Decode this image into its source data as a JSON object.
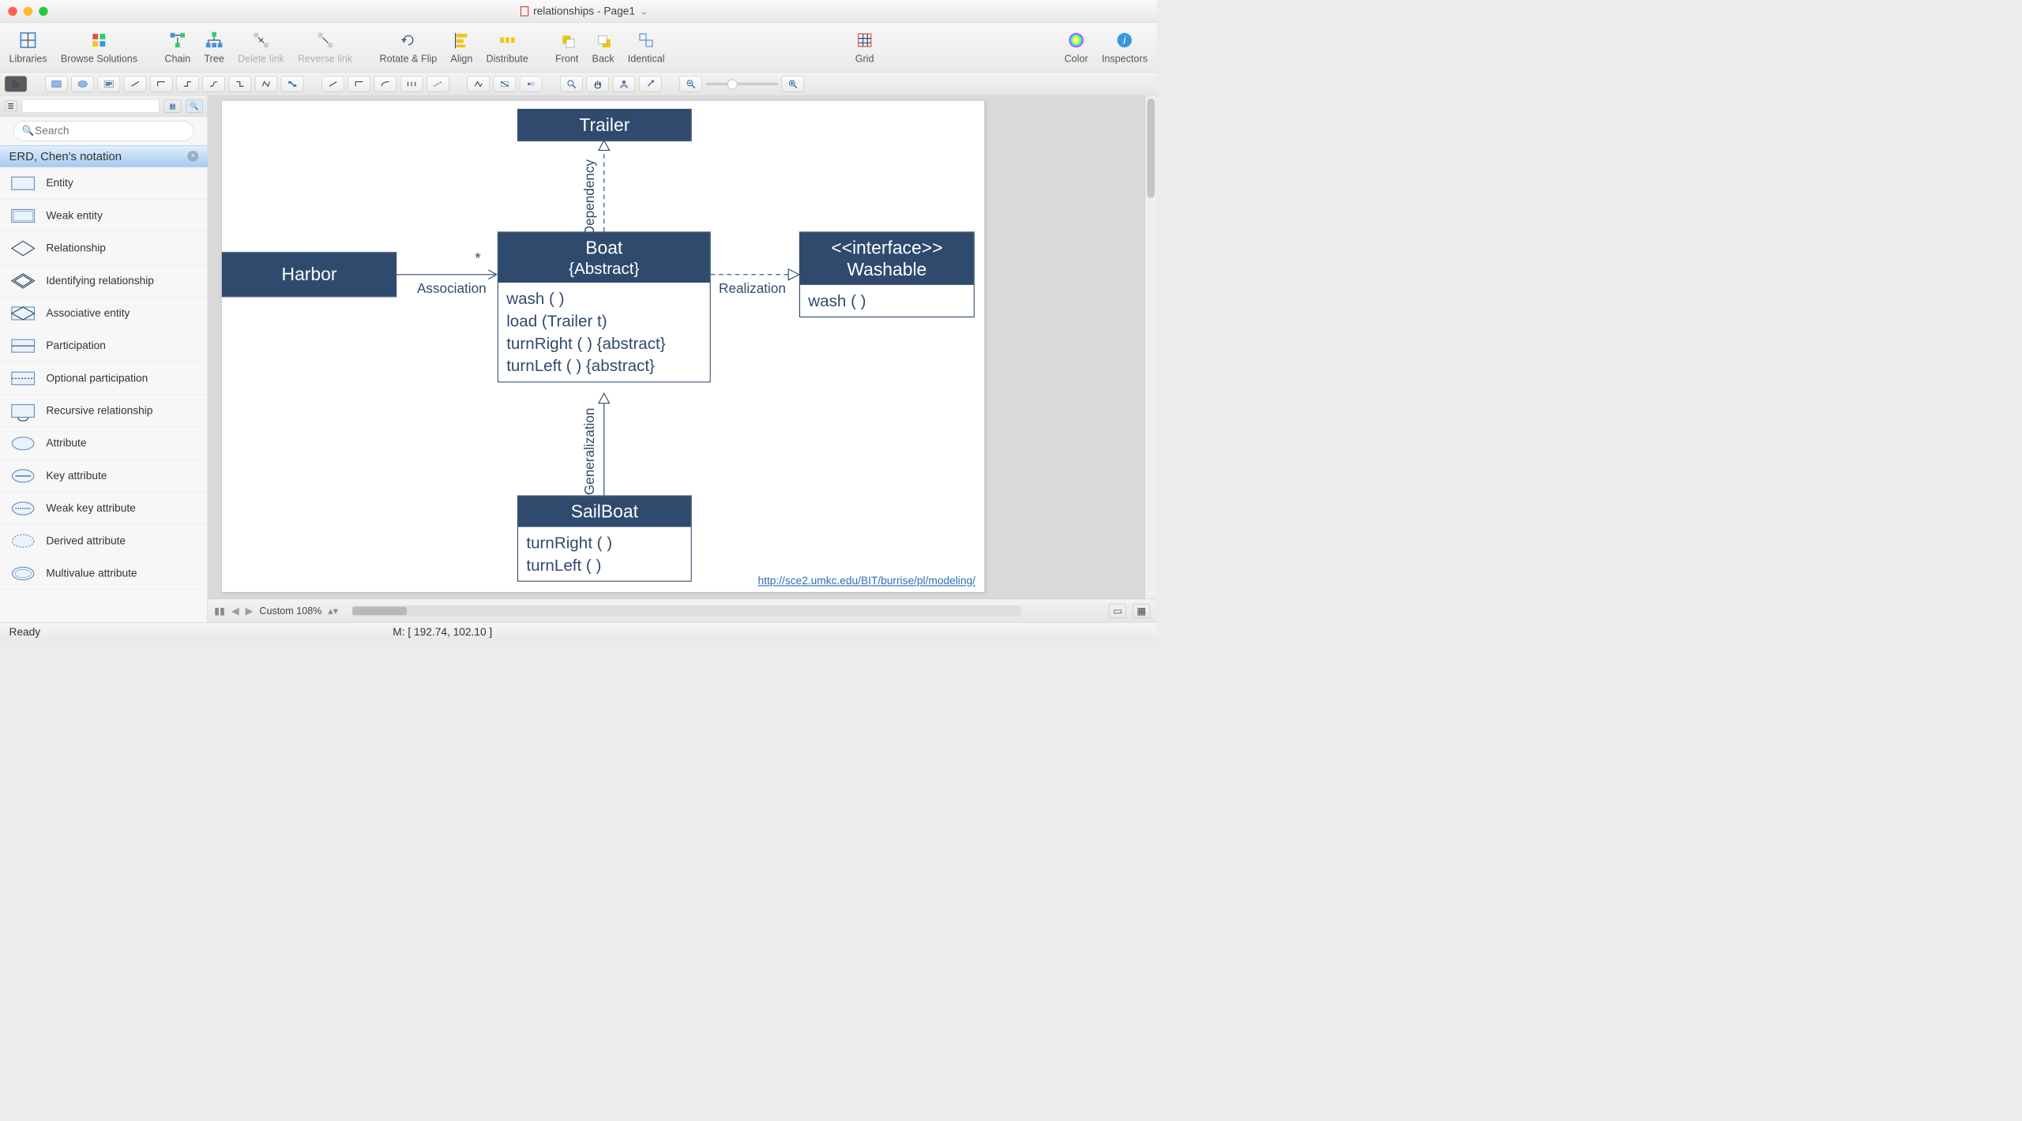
{
  "window": {
    "title": "relationships - Page1"
  },
  "toolbar": {
    "libraries": "Libraries",
    "browse": "Browse Solutions",
    "chain": "Chain",
    "tree": "Tree",
    "delete_link": "Delete link",
    "reverse_link": "Reverse link",
    "rotate_flip": "Rotate & Flip",
    "align": "Align",
    "distribute": "Distribute",
    "front": "Front",
    "back": "Back",
    "identical": "Identical",
    "grid": "Grid",
    "color": "Color",
    "inspectors": "Inspectors"
  },
  "sidebar": {
    "search_placeholder": "Search",
    "panel_title": "ERD, Chen's notation",
    "shapes": [
      "Entity",
      "Weak entity",
      "Relationship",
      "Identifying relationship",
      "Associative entity",
      "Participation",
      "Optional participation",
      "Recursive relationship",
      "Attribute",
      "Key attribute",
      "Weak key attribute",
      "Derived attribute",
      "Multivalue attribute"
    ]
  },
  "diagram": {
    "trailer": "Trailer",
    "harbor": "Harbor",
    "boat_name": "Boat",
    "boat_mod": "{Abstract}",
    "boat_ops": [
      "wash ( )",
      "load (Trailer t)",
      "turnRight ( ) {abstract}",
      "turnLeft ( ) {abstract}"
    ],
    "interface_stereo": "<<interface>>",
    "interface_name": "Washable",
    "interface_ops": [
      "wash ( )"
    ],
    "sailboat": "SailBoat",
    "sailboat_ops": [
      "turnRight ( )",
      "turnLeft ( )"
    ],
    "assoc_label": "Association",
    "assoc_mult": "*",
    "dep_label": "Dependency",
    "real_label": "Realization",
    "gen_label": "Generalization",
    "link": "http://sce2.umkc.edu/BIT/burrise/pl/modeling/"
  },
  "footer": {
    "zoom_label": "Custom 108%"
  },
  "status": {
    "ready": "Ready",
    "mouse": "M: [ 192.74, 102.10 ]"
  }
}
